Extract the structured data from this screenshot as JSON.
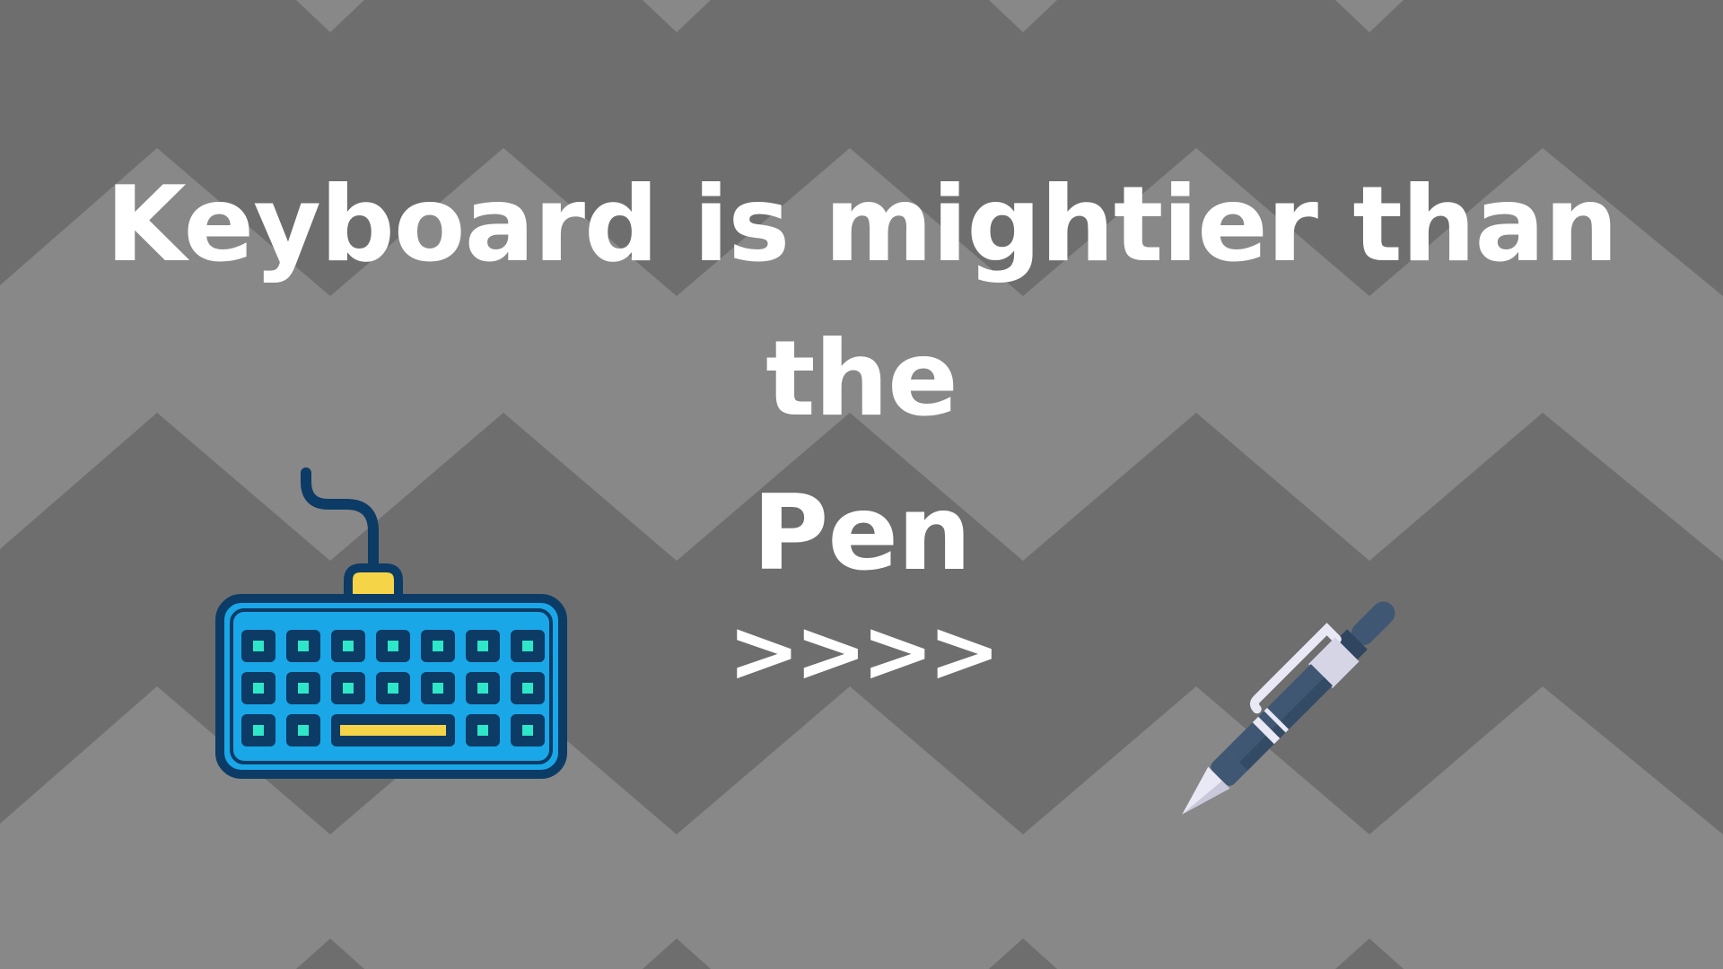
{
  "headline": {
    "line1": "Keyboard is mightier than the",
    "line2": "Pen"
  },
  "comparison": "»»",
  "comparison_text": ">>>>",
  "icons": {
    "left": "keyboard-icon",
    "right": "pen-icon"
  },
  "colors": {
    "background_dark": "#6e6e6e",
    "background_light": "#888888",
    "text": "#ffffff",
    "keyboard_body": "#1aa7e8",
    "keyboard_outline": "#0c3b66",
    "keyboard_key_dot": "#2ee6c8",
    "keyboard_accent": "#f6d447",
    "pen_body": "#3f5773",
    "pen_tip": "#e9e8f5"
  }
}
